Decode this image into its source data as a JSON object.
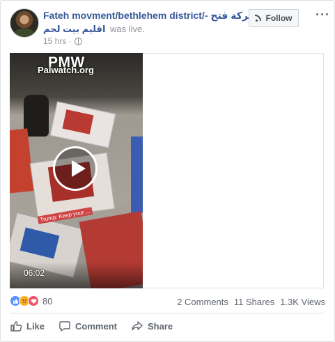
{
  "post": {
    "author_name": "Fateh movment/bethlehem district/- حركة فتح",
    "author_line2_rtl": "اقليم بيت لحم",
    "live_text": "was live.",
    "time": "15 hrs ·",
    "follow_label": "Follow",
    "more_label": "···"
  },
  "video": {
    "watermark_title": "PMW",
    "watermark_sub": "Palwatch.org",
    "poster_caption": "Trump: Keep your ...",
    "duration": "06:02"
  },
  "engagement": {
    "reaction_count": "80",
    "comments": "2 Comments",
    "shares": "11 Shares",
    "views": "1.3K Views"
  },
  "actions": {
    "like": "Like",
    "comment": "Comment",
    "share": "Share"
  },
  "colors": {
    "link": "#365899",
    "muted": "#90949c",
    "border": "#dddfe2",
    "like_blue": "#5890ff",
    "sad_yellow": "#f7b125",
    "love_red": "#f25268"
  }
}
